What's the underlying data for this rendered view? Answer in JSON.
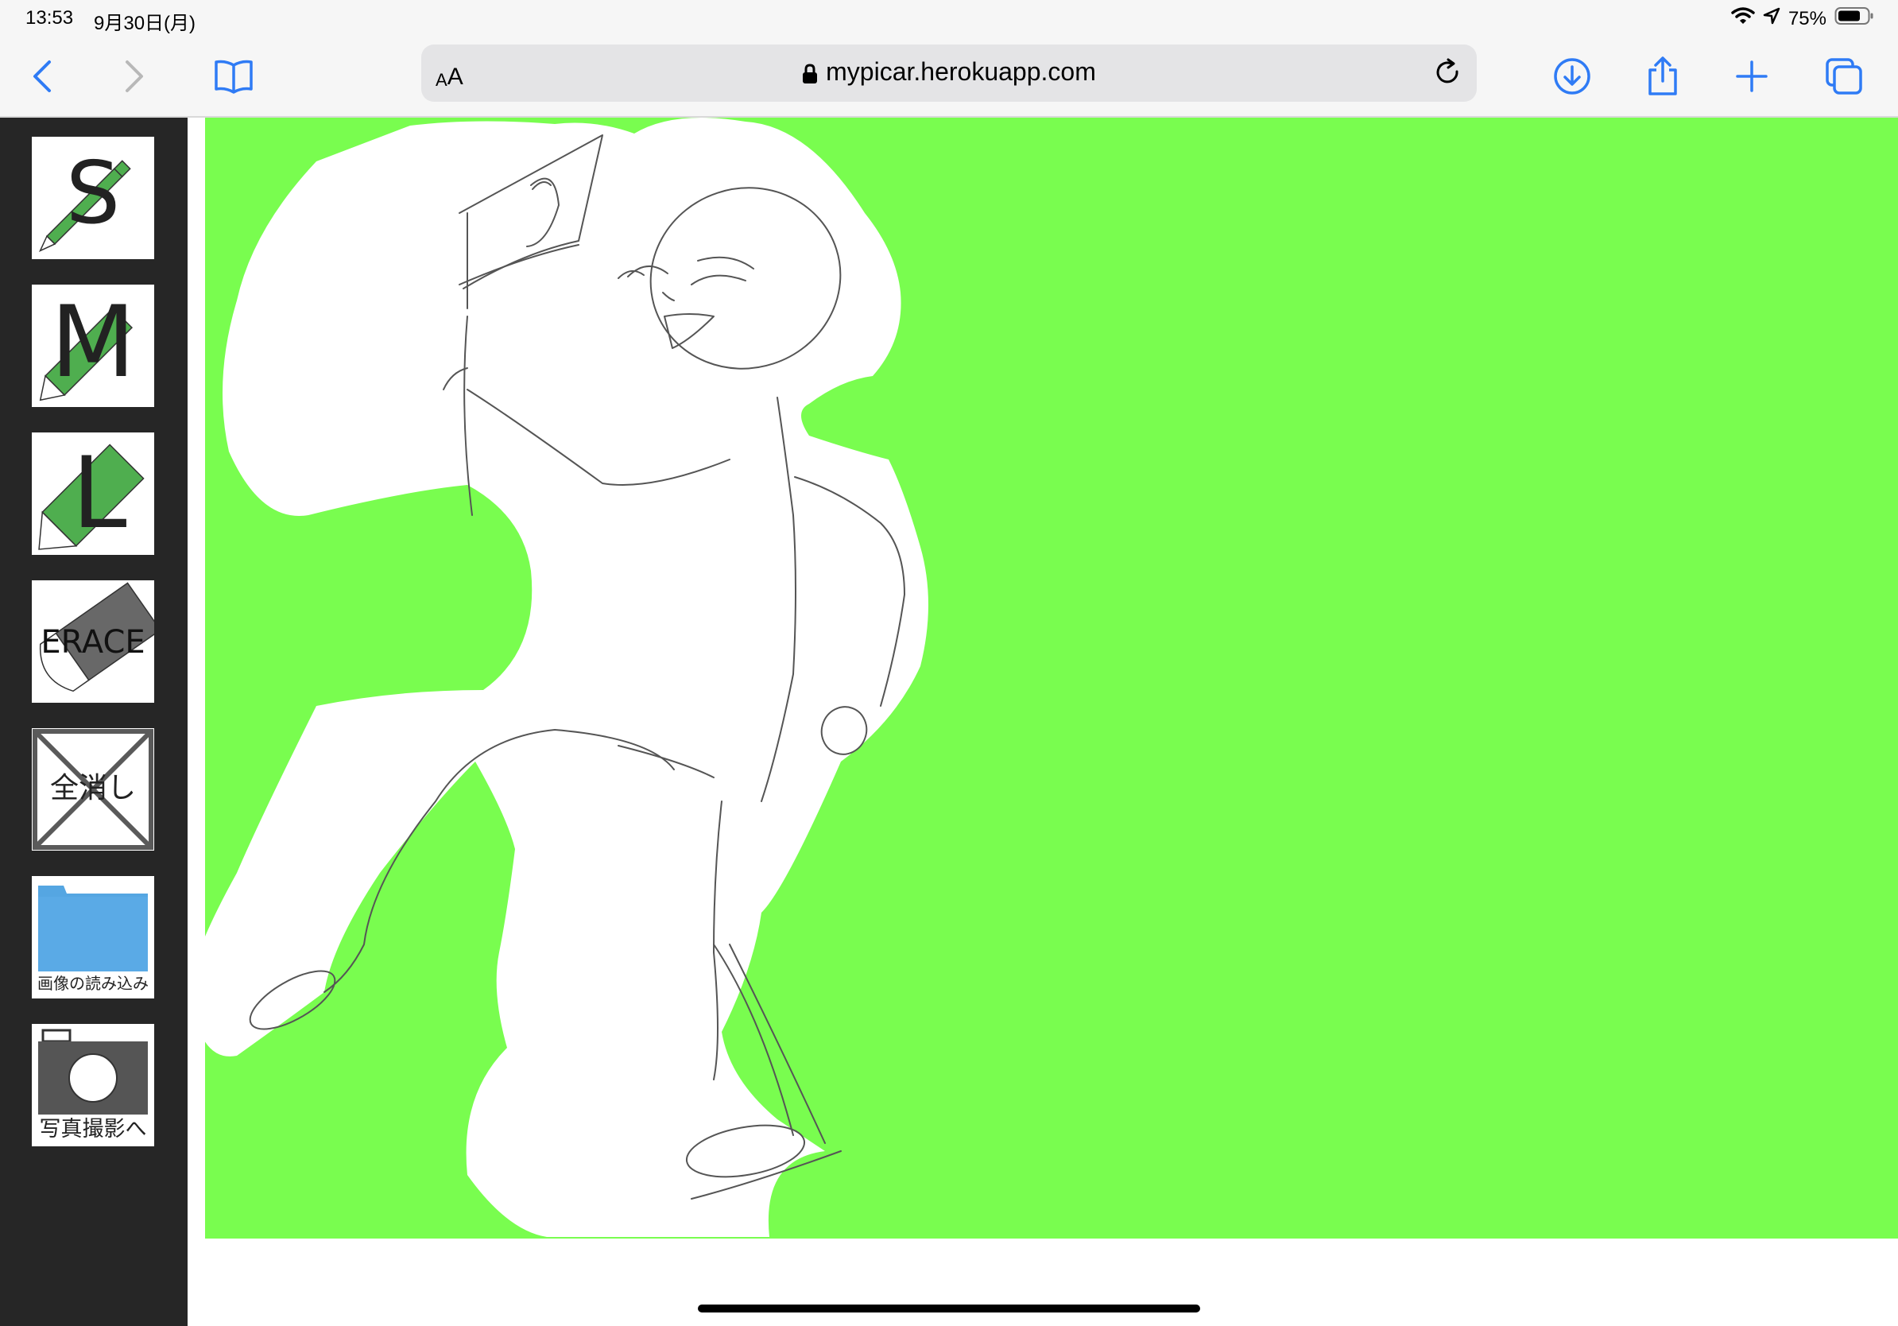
{
  "status_bar": {
    "time": "13:53",
    "date": "9月30日(月)",
    "battery_percent": "75%",
    "icons": [
      "wifi-icon",
      "location-icon",
      "battery-icon"
    ]
  },
  "browser": {
    "text_size_small": "A",
    "text_size_large": "A",
    "url": "mypicar.herokuapp.com",
    "buttons": [
      "back",
      "forward",
      "bookmarks",
      "reload",
      "downloads",
      "share",
      "new-tab",
      "tabs"
    ]
  },
  "tools": {
    "small_pen": "S",
    "medium_pen": "M",
    "large_pen": "L",
    "eraser": "ERACE",
    "clear_all": "全消し",
    "load_image": "画像の読み込み",
    "take_photo": "写真撮影へ"
  },
  "colors": {
    "canvas_background": "#79fd4f",
    "panel_background": "#262626",
    "pen_green": "#4fae4f",
    "ios_blue": "#2f7bf5"
  }
}
